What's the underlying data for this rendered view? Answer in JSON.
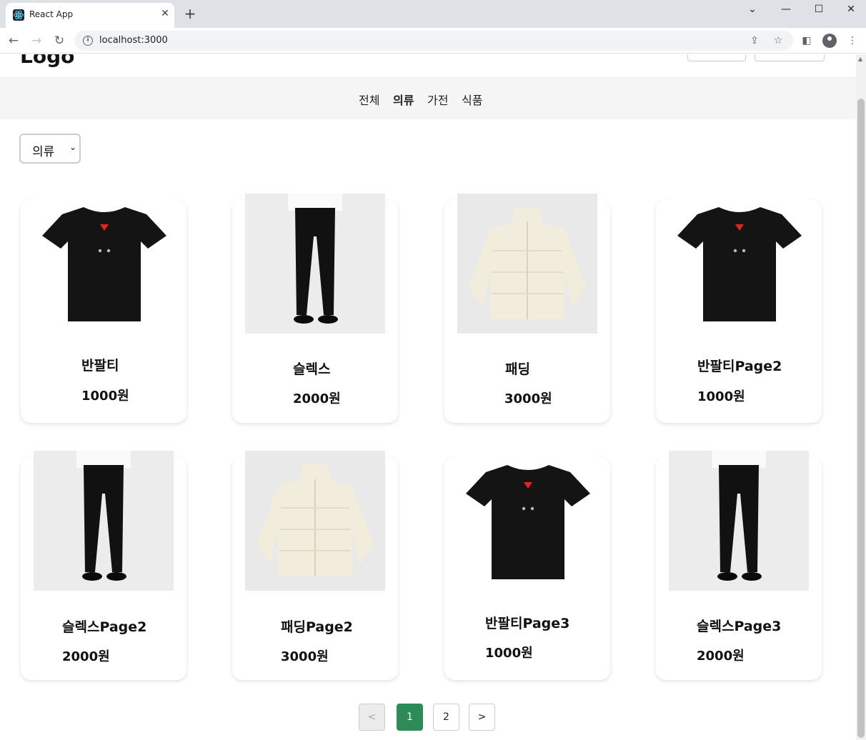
{
  "browser": {
    "tab_title": "React App",
    "tab_close": "✕",
    "new_tab": "+",
    "url": "localhost:3000",
    "window_controls": [
      "⌄",
      "—",
      "☐",
      "✕"
    ]
  },
  "header": {
    "logo": "Logo"
  },
  "categories": [
    {
      "label": "전체",
      "active": false
    },
    {
      "label": "의류",
      "active": true
    },
    {
      "label": "가전",
      "active": false
    },
    {
      "label": "식품",
      "active": false
    }
  ],
  "filter": {
    "selected": "의류"
  },
  "products": [
    {
      "name": "반팔티",
      "price": "1000원",
      "image": "black-tshirt"
    },
    {
      "name": "슬렉스",
      "price": "2000원",
      "image": "black-slacks"
    },
    {
      "name": "패딩",
      "price": "3000원",
      "image": "cream-padding"
    },
    {
      "name": "반팔티Page2",
      "price": "1000원",
      "image": "black-tshirt"
    },
    {
      "name": "슬렉스Page2",
      "price": "2000원",
      "image": "black-slacks"
    },
    {
      "name": "패딩Page2",
      "price": "3000원",
      "image": "cream-padding"
    },
    {
      "name": "반팔티Page3",
      "price": "1000원",
      "image": "black-tshirt"
    },
    {
      "name": "슬렉스Page3",
      "price": "2000원",
      "image": "black-slacks"
    }
  ],
  "pagination": {
    "prev": "<",
    "pages": [
      "1",
      "2"
    ],
    "current": "1",
    "next": ">"
  },
  "colors": {
    "active_page": "#2e8b57",
    "category_bar": "#f5f5f5"
  }
}
